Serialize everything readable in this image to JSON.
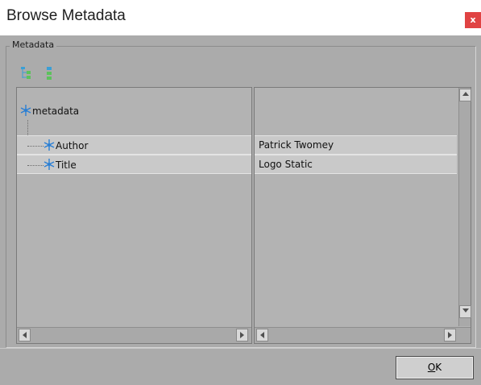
{
  "window": {
    "title": "Browse Metadata",
    "close_label": "x"
  },
  "group": {
    "legend": "Metadata"
  },
  "toolbar": {
    "icons": [
      {
        "name": "expand-all-icon"
      },
      {
        "name": "collapse-all-icon"
      }
    ]
  },
  "tree": {
    "root": {
      "label": "metadata",
      "icon": "node-icon"
    },
    "children": [
      {
        "label": "Author",
        "value": "Patrick Twomey",
        "icon": "node-icon"
      },
      {
        "label": "Title",
        "value": "Logo Static",
        "icon": "node-icon"
      }
    ]
  },
  "footer": {
    "ok_label_mnemonic": "O",
    "ok_label_rest": "K"
  },
  "colors": {
    "close_button": "#e04343",
    "dialog_background": "#ababab",
    "row_background": "#c9c9c9",
    "node_icon": "#2a7fd4"
  }
}
